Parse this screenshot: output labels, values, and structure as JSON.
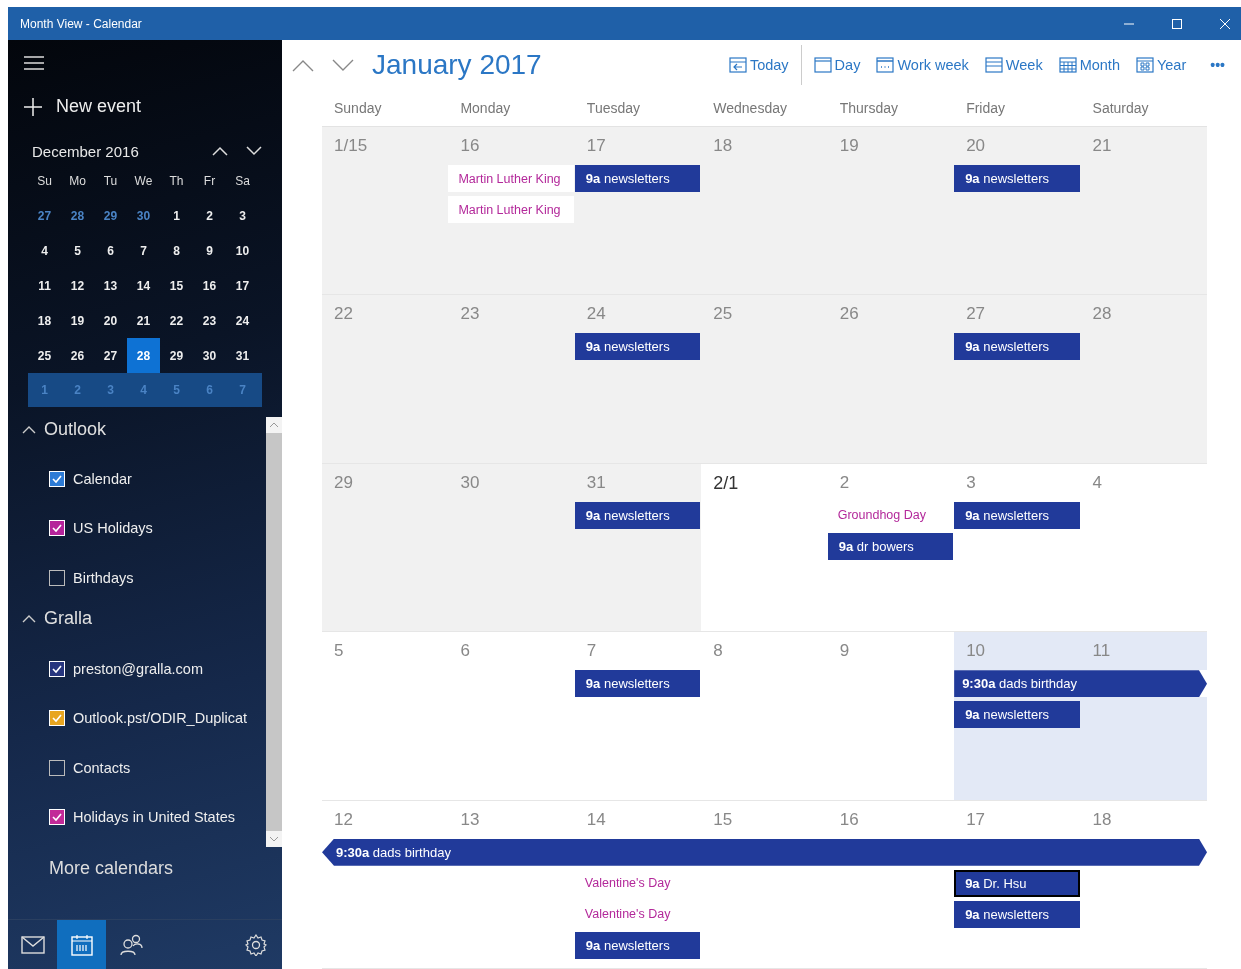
{
  "window": {
    "title": "Month View - Calendar"
  },
  "sidebar": {
    "new_event": "New event",
    "mini_calendar": {
      "title": "December 2016",
      "weekdays": [
        "Su",
        "Mo",
        "Tu",
        "We",
        "Th",
        "Fr",
        "Sa"
      ],
      "weeks": [
        {
          "highlighted": false,
          "days": [
            {
              "label": "27",
              "other_month": true,
              "selected": false
            },
            {
              "label": "28",
              "other_month": true,
              "selected": false
            },
            {
              "label": "29",
              "other_month": true,
              "selected": false
            },
            {
              "label": "30",
              "other_month": true,
              "selected": false
            },
            {
              "label": "1",
              "other_month": false,
              "selected": false
            },
            {
              "label": "2",
              "other_month": false,
              "selected": false
            },
            {
              "label": "3",
              "other_month": false,
              "selected": false
            }
          ]
        },
        {
          "highlighted": false,
          "days": [
            {
              "label": "4",
              "other_month": false,
              "selected": false
            },
            {
              "label": "5",
              "other_month": false,
              "selected": false
            },
            {
              "label": "6",
              "other_month": false,
              "selected": false
            },
            {
              "label": "7",
              "other_month": false,
              "selected": false
            },
            {
              "label": "8",
              "other_month": false,
              "selected": false
            },
            {
              "label": "9",
              "other_month": false,
              "selected": false
            },
            {
              "label": "10",
              "other_month": false,
              "selected": false
            }
          ]
        },
        {
          "highlighted": false,
          "days": [
            {
              "label": "11",
              "other_month": false,
              "selected": false
            },
            {
              "label": "12",
              "other_month": false,
              "selected": false
            },
            {
              "label": "13",
              "other_month": false,
              "selected": false
            },
            {
              "label": "14",
              "other_month": false,
              "selected": false
            },
            {
              "label": "15",
              "other_month": false,
              "selected": false
            },
            {
              "label": "16",
              "other_month": false,
              "selected": false
            },
            {
              "label": "17",
              "other_month": false,
              "selected": false
            }
          ]
        },
        {
          "highlighted": false,
          "days": [
            {
              "label": "18",
              "other_month": false,
              "selected": false
            },
            {
              "label": "19",
              "other_month": false,
              "selected": false
            },
            {
              "label": "20",
              "other_month": false,
              "selected": false
            },
            {
              "label": "21",
              "other_month": false,
              "selected": false
            },
            {
              "label": "22",
              "other_month": false,
              "selected": false
            },
            {
              "label": "23",
              "other_month": false,
              "selected": false
            },
            {
              "label": "24",
              "other_month": false,
              "selected": false
            }
          ]
        },
        {
          "highlighted": false,
          "days": [
            {
              "label": "25",
              "other_month": false,
              "selected": false
            },
            {
              "label": "26",
              "other_month": false,
              "selected": false
            },
            {
              "label": "27",
              "other_month": false,
              "selected": false
            },
            {
              "label": "28",
              "other_month": false,
              "selected": true
            },
            {
              "label": "29",
              "other_month": false,
              "selected": false
            },
            {
              "label": "30",
              "other_month": false,
              "selected": false
            },
            {
              "label": "31",
              "other_month": false,
              "selected": false
            }
          ]
        },
        {
          "highlighted": true,
          "days": [
            {
              "label": "1",
              "other_month": true,
              "selected": false
            },
            {
              "label": "2",
              "other_month": true,
              "selected": false
            },
            {
              "label": "3",
              "other_month": true,
              "selected": false
            },
            {
              "label": "4",
              "other_month": true,
              "selected": false
            },
            {
              "label": "5",
              "other_month": true,
              "selected": false
            },
            {
              "label": "6",
              "other_month": true,
              "selected": false
            },
            {
              "label": "7",
              "other_month": true,
              "selected": false
            }
          ]
        }
      ]
    },
    "groups": [
      {
        "name": "Outlook",
        "expanded": true,
        "items": [
          {
            "label": "Calendar",
            "checked": true,
            "color": "#2d7bd6"
          },
          {
            "label": "US Holidays",
            "checked": true,
            "color": "#b5239a"
          },
          {
            "label": "Birthdays",
            "checked": false
          }
        ]
      },
      {
        "name": "Gralla",
        "expanded": true,
        "items": [
          {
            "label": "preston@gralla.com",
            "checked": true,
            "color": "#26357e"
          },
          {
            "label": "Outlook.pst/ODIR_Duplicat",
            "checked": true,
            "color": "#e8a520"
          },
          {
            "label": "Contacts",
            "checked": false
          },
          {
            "label": "Holidays in United States",
            "checked": true,
            "color": "#c22a98"
          }
        ]
      }
    ],
    "more_calendars": "More calendars",
    "nav": [
      {
        "kind": "mail",
        "selected": false
      },
      {
        "kind": "calendar",
        "selected": true
      },
      {
        "kind": "people",
        "selected": false
      },
      {
        "kind": "settings",
        "selected": false
      }
    ]
  },
  "header": {
    "month": "January 2017",
    "views": [
      {
        "kind": "today",
        "label": "Today"
      },
      {
        "kind": "day",
        "label": "Day"
      },
      {
        "kind": "workweek",
        "label": "Work week"
      },
      {
        "kind": "week",
        "label": "Week"
      },
      {
        "kind": "month",
        "label": "Month"
      },
      {
        "kind": "year",
        "label": "Year"
      }
    ],
    "more": "•••"
  },
  "weekdays": [
    "Sunday",
    "Monday",
    "Tuesday",
    "Wednesday",
    "Thursday",
    "Friday",
    "Saturday"
  ],
  "weeks": [
    {
      "days": [
        {
          "day": "1/15",
          "in_month": true,
          "selected": false,
          "month_start": false
        },
        {
          "day": "16",
          "in_month": true,
          "selected": false,
          "month_start": false,
          "events": [
            {
              "kind": "holiday",
              "title": "Martin Luther King"
            },
            {
              "kind": "holiday",
              "title": "Martin Luther King"
            }
          ]
        },
        {
          "day": "17",
          "in_month": true,
          "selected": false,
          "month_start": false,
          "events": [
            {
              "kind": "appointment",
              "time": "9a",
              "title": "newsletters",
              "selected": false
            }
          ]
        },
        {
          "day": "18",
          "in_month": true,
          "selected": false,
          "month_start": false
        },
        {
          "day": "19",
          "in_month": true,
          "selected": false,
          "month_start": false
        },
        {
          "day": "20",
          "in_month": true,
          "selected": false,
          "month_start": false,
          "events": [
            {
              "kind": "appointment",
              "time": "9a",
              "title": "newsletters",
              "selected": false
            }
          ]
        },
        {
          "day": "21",
          "in_month": true,
          "selected": false,
          "month_start": false
        }
      ]
    },
    {
      "days": [
        {
          "day": "22",
          "in_month": true,
          "selected": false,
          "month_start": false
        },
        {
          "day": "23",
          "in_month": true,
          "selected": false,
          "month_start": false
        },
        {
          "day": "24",
          "in_month": true,
          "selected": false,
          "month_start": false,
          "events": [
            {
              "kind": "appointment",
              "time": "9a",
              "title": "newsletters",
              "selected": false
            }
          ]
        },
        {
          "day": "25",
          "in_month": true,
          "selected": false,
          "month_start": false
        },
        {
          "day": "26",
          "in_month": true,
          "selected": false,
          "month_start": false
        },
        {
          "day": "27",
          "in_month": true,
          "selected": false,
          "month_start": false,
          "events": [
            {
              "kind": "appointment",
              "time": "9a",
              "title": "newsletters",
              "selected": false
            }
          ]
        },
        {
          "day": "28",
          "in_month": true,
          "selected": false,
          "month_start": false
        }
      ]
    },
    {
      "days": [
        {
          "day": "29",
          "in_month": true,
          "selected": false,
          "month_start": false
        },
        {
          "day": "30",
          "in_month": true,
          "selected": false,
          "month_start": false
        },
        {
          "day": "31",
          "in_month": true,
          "selected": false,
          "month_start": false,
          "events": [
            {
              "kind": "appointment",
              "time": "9a",
              "title": "newsletters",
              "selected": false
            }
          ]
        },
        {
          "day": "2/1",
          "in_month": false,
          "selected": false,
          "month_start": true
        },
        {
          "day": "2",
          "in_month": false,
          "selected": false,
          "month_start": false,
          "events": [
            {
              "kind": "holiday",
              "title": "Groundhog Day"
            },
            {
              "kind": "appointment",
              "time": "9a",
              "title": "dr bowers",
              "selected": false
            }
          ]
        },
        {
          "day": "3",
          "in_month": false,
          "selected": false,
          "month_start": false,
          "events": [
            {
              "kind": "appointment",
              "time": "9a",
              "title": "newsletters",
              "selected": false
            }
          ]
        },
        {
          "day": "4",
          "in_month": false,
          "selected": false,
          "month_start": false
        }
      ]
    },
    {
      "days": [
        {
          "day": "5",
          "in_month": false,
          "selected": false,
          "month_start": false
        },
        {
          "day": "6",
          "in_month": false,
          "selected": false,
          "month_start": false
        },
        {
          "day": "7",
          "in_month": false,
          "selected": false,
          "month_start": false,
          "events": [
            {
              "kind": "appointment",
              "time": "9a",
              "title": "newsletters",
              "selected": false
            }
          ]
        },
        {
          "day": "8",
          "in_month": false,
          "selected": false,
          "month_start": false
        },
        {
          "day": "9",
          "in_month": false,
          "selected": false,
          "month_start": false
        },
        {
          "day": "10",
          "in_month": false,
          "selected": true,
          "month_start": false,
          "events": [
            {
              "kind": "multi_day",
              "time": "9:30a",
              "title": "dads birthday",
              "continues_before": false,
              "continues_after": true
            },
            {
              "kind": "appointment",
              "time": "9a",
              "title": "newsletters",
              "selected": false
            }
          ]
        },
        {
          "day": "11",
          "in_month": false,
          "selected": true,
          "month_start": false
        }
      ]
    },
    {
      "days": [
        {
          "day": "12",
          "in_month": false,
          "selected": false,
          "month_start": false,
          "events": [
            {
              "kind": "multi_day",
              "time": "9:30a",
              "title": "dads birthday",
              "continues_before": true,
              "continues_after": true
            }
          ]
        },
        {
          "day": "13",
          "in_month": false,
          "selected": false,
          "month_start": false
        },
        {
          "day": "14",
          "in_month": false,
          "selected": false,
          "month_start": false,
          "events": [
            {
              "kind": "holiday",
              "title": "Valentine's Day"
            },
            {
              "kind": "holiday",
              "title": "Valentine's Day"
            },
            {
              "kind": "appointment",
              "time": "9a",
              "title": "newsletters",
              "selected": false
            }
          ]
        },
        {
          "day": "15",
          "in_month": false,
          "selected": false,
          "month_start": false
        },
        {
          "day": "16",
          "in_month": false,
          "selected": false,
          "month_start": false
        },
        {
          "day": "17",
          "in_month": false,
          "selected": false,
          "month_start": false,
          "events": [
            {
              "kind": "appointment",
              "time": "9a",
              "title": "Dr. Hsu",
              "selected": true
            },
            {
              "kind": "appointment",
              "time": "9a",
              "title": "newsletters",
              "selected": false
            }
          ]
        },
        {
          "day": "18",
          "in_month": false,
          "selected": false,
          "month_start": false
        }
      ]
    }
  ]
}
